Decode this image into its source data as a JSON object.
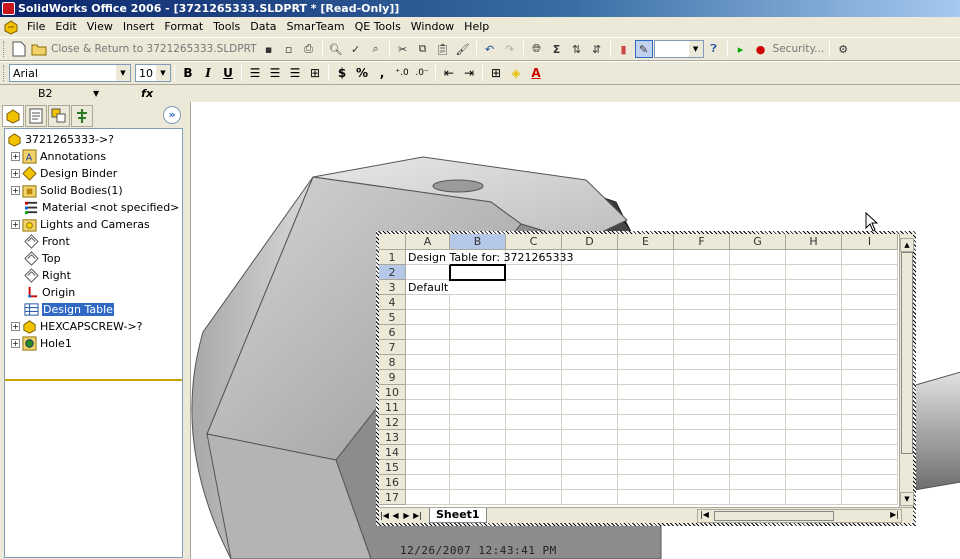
{
  "window": {
    "title": "SolidWorks Office 2006 - [3721265333.SLDPRT * [Read-Only]]"
  },
  "menu": [
    "File",
    "Edit",
    "View",
    "Insert",
    "Format",
    "Tools",
    "Data",
    "SmarTeam",
    "QE Tools",
    "Window",
    "Help"
  ],
  "toolbar1": {
    "close_return_label": "Close & Return to 3721265333.SLDPRT",
    "security_label": "Security..."
  },
  "toolbar2": {
    "font": "Arial",
    "size": "10",
    "bold": "B",
    "italic": "I",
    "underline": "U",
    "currency": "$",
    "percent": "%",
    "comma": ","
  },
  "formula_bar": {
    "name_box": "B2",
    "fx": "fx"
  },
  "tree": {
    "root": "3721265333->?",
    "items": [
      "Annotations",
      "Design Binder",
      "Solid Bodies(1)",
      "Material <not specified>",
      "Lights and Cameras",
      "Front",
      "Top",
      "Right",
      "Origin",
      "Design Table",
      "HEXCAPSCREW->?",
      "Hole1"
    ],
    "selected": "Design Table"
  },
  "sheet": {
    "columns": [
      "A",
      "B",
      "C",
      "D",
      "E",
      "F",
      "G",
      "H",
      "I"
    ],
    "rows": [
      "1",
      "2",
      "3",
      "4",
      "5",
      "6",
      "7",
      "8",
      "9",
      "10",
      "11",
      "12",
      "13",
      "14",
      "15",
      "16",
      "17"
    ],
    "cells": {
      "A1": "Design Table for: 3721265333",
      "A3": "Default"
    },
    "active_cell": "B2",
    "tab": "Sheet1"
  },
  "timestamp": "12/26/2007 12:43:41 PM",
  "colors": {
    "title_bar": "#0a246a",
    "selection": "#316ac5",
    "chrome": "#ece9d8"
  }
}
